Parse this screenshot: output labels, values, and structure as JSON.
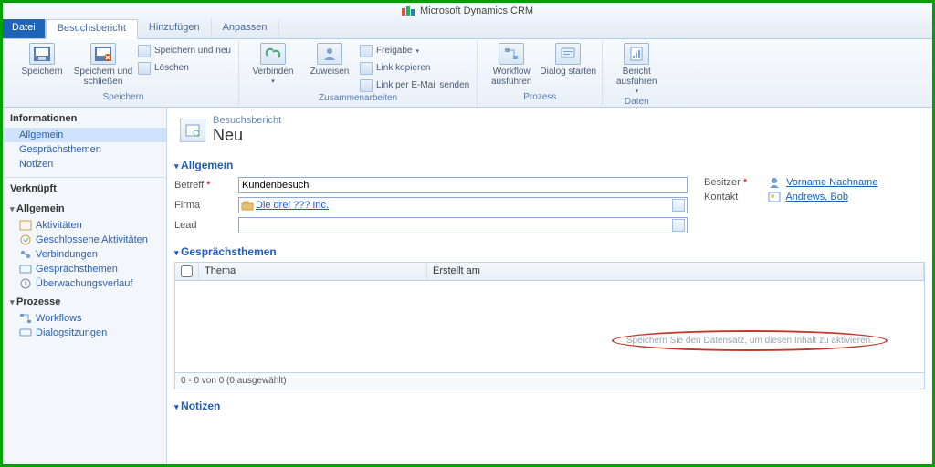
{
  "title": "Microsoft Dynamics CRM",
  "tabs": {
    "file": "Datei",
    "main": "Besuchsbericht",
    "add": "Hinzufügen",
    "custom": "Anpassen"
  },
  "ribbon": {
    "save": "Speichern",
    "saveclose": "Speichern und schließen",
    "savenew": "Speichern und neu",
    "delete": "Löschen",
    "g_save": "Speichern",
    "connect": "Verbinden",
    "assign": "Zuweisen",
    "share": "Freigabe",
    "copylink": "Link kopieren",
    "emaillink": "Link per E-Mail senden",
    "g_collab": "Zusammenarbeiten",
    "workflow": "Workflow ausführen",
    "dialog": "Dialog starten",
    "g_process": "Prozess",
    "report": "Bericht ausführen",
    "g_data": "Daten"
  },
  "leftnav": {
    "info": "Informationen",
    "items_info": [
      "Allgemein",
      "Gesprächsthemen",
      "Notizen"
    ],
    "linked": "Verknüpft",
    "allgemein": "Allgemein",
    "items_allg": [
      "Aktivitäten",
      "Geschlossene Aktivitäten",
      "Verbindungen",
      "Gesprächsthemen",
      "Überwachungsverlauf"
    ],
    "prozesse": "Prozesse",
    "items_proc": [
      "Workflows",
      "Dialogsitzungen"
    ]
  },
  "page": {
    "type": "Besuchsbericht",
    "title": "Neu"
  },
  "sections": {
    "general": "Allgemein",
    "topics": "Gesprächsthemen",
    "notes": "Notizen"
  },
  "fields": {
    "betreff_label": "Betreff",
    "betreff_value": "Kundenbesuch",
    "firma_label": "Firma",
    "firma_value": "Die drei ??? Inc.",
    "lead_label": "Lead",
    "besitzer_label": "Besitzer",
    "besitzer_value": "Vorname Nachname",
    "kontakt_label": "Kontakt",
    "kontakt_value": "Andrews, Bob"
  },
  "grid": {
    "col_thema": "Thema",
    "col_erstellt": "Erstellt am",
    "placeholder": "Speichern Sie den Datensatz, um diesen Inhalt zu aktivieren.",
    "footer": "0 - 0  von 0 (0 ausgewählt)"
  }
}
